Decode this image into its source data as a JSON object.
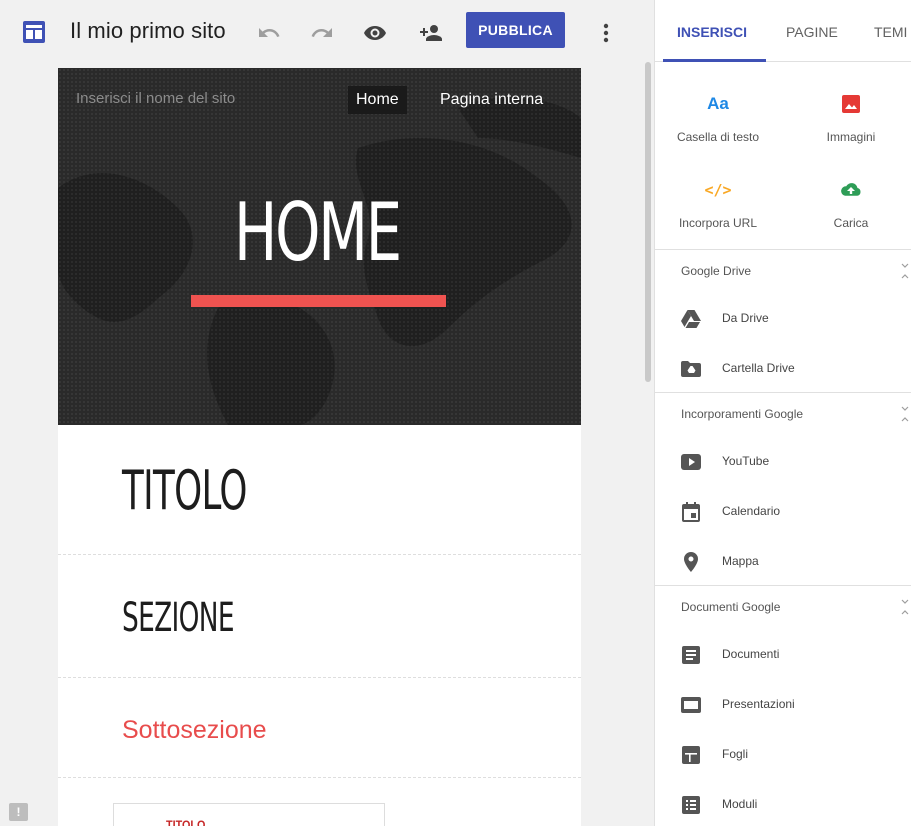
{
  "topbar": {
    "site_title": "Il mio primo sito",
    "publish_label": "PUBBLICA"
  },
  "canvas": {
    "site_name_placeholder": "Inserisci il nome del sito",
    "nav": [
      "Home",
      "Pagina interna"
    ],
    "hero_title": "HOME",
    "heading_title": "TITOLO",
    "heading_section": "SEZIONE",
    "heading_subsection": "Sottosezione",
    "mini_card_title": "TITOLO"
  },
  "panel": {
    "tabs": [
      "INSERISCI",
      "PAGINE",
      "TEMI"
    ],
    "active_tab": "INSERISCI",
    "tiles": [
      {
        "label": "Casella di testo",
        "icon": "text-box-icon"
      },
      {
        "label": "Immagini",
        "icon": "image-icon"
      },
      {
        "label": "Incorpora URL",
        "icon": "embed-code-icon"
      },
      {
        "label": "Carica",
        "icon": "upload-cloud-icon"
      }
    ],
    "groups": [
      {
        "title": "Google Drive",
        "items": [
          {
            "label": "Da Drive",
            "icon": "drive-icon"
          },
          {
            "label": "Cartella Drive",
            "icon": "drive-folder-icon"
          }
        ]
      },
      {
        "title": "Incorporamenti Google",
        "items": [
          {
            "label": "YouTube",
            "icon": "youtube-icon"
          },
          {
            "label": "Calendario",
            "icon": "calendar-icon"
          },
          {
            "label": "Mappa",
            "icon": "map-pin-icon"
          }
        ]
      },
      {
        "title": "Documenti Google",
        "items": [
          {
            "label": "Documenti",
            "icon": "docs-icon"
          },
          {
            "label": "Presentazioni",
            "icon": "slides-icon"
          },
          {
            "label": "Fogli",
            "icon": "sheets-icon"
          },
          {
            "label": "Moduli",
            "icon": "forms-icon"
          }
        ]
      }
    ]
  },
  "colors": {
    "accent": "#3f51b5",
    "hero_bar": "#ef5350",
    "subsection": "#e84c4c",
    "images_icon": "#e53935",
    "embed_icon": "#f9a825",
    "upload_icon": "#2e9d57"
  }
}
